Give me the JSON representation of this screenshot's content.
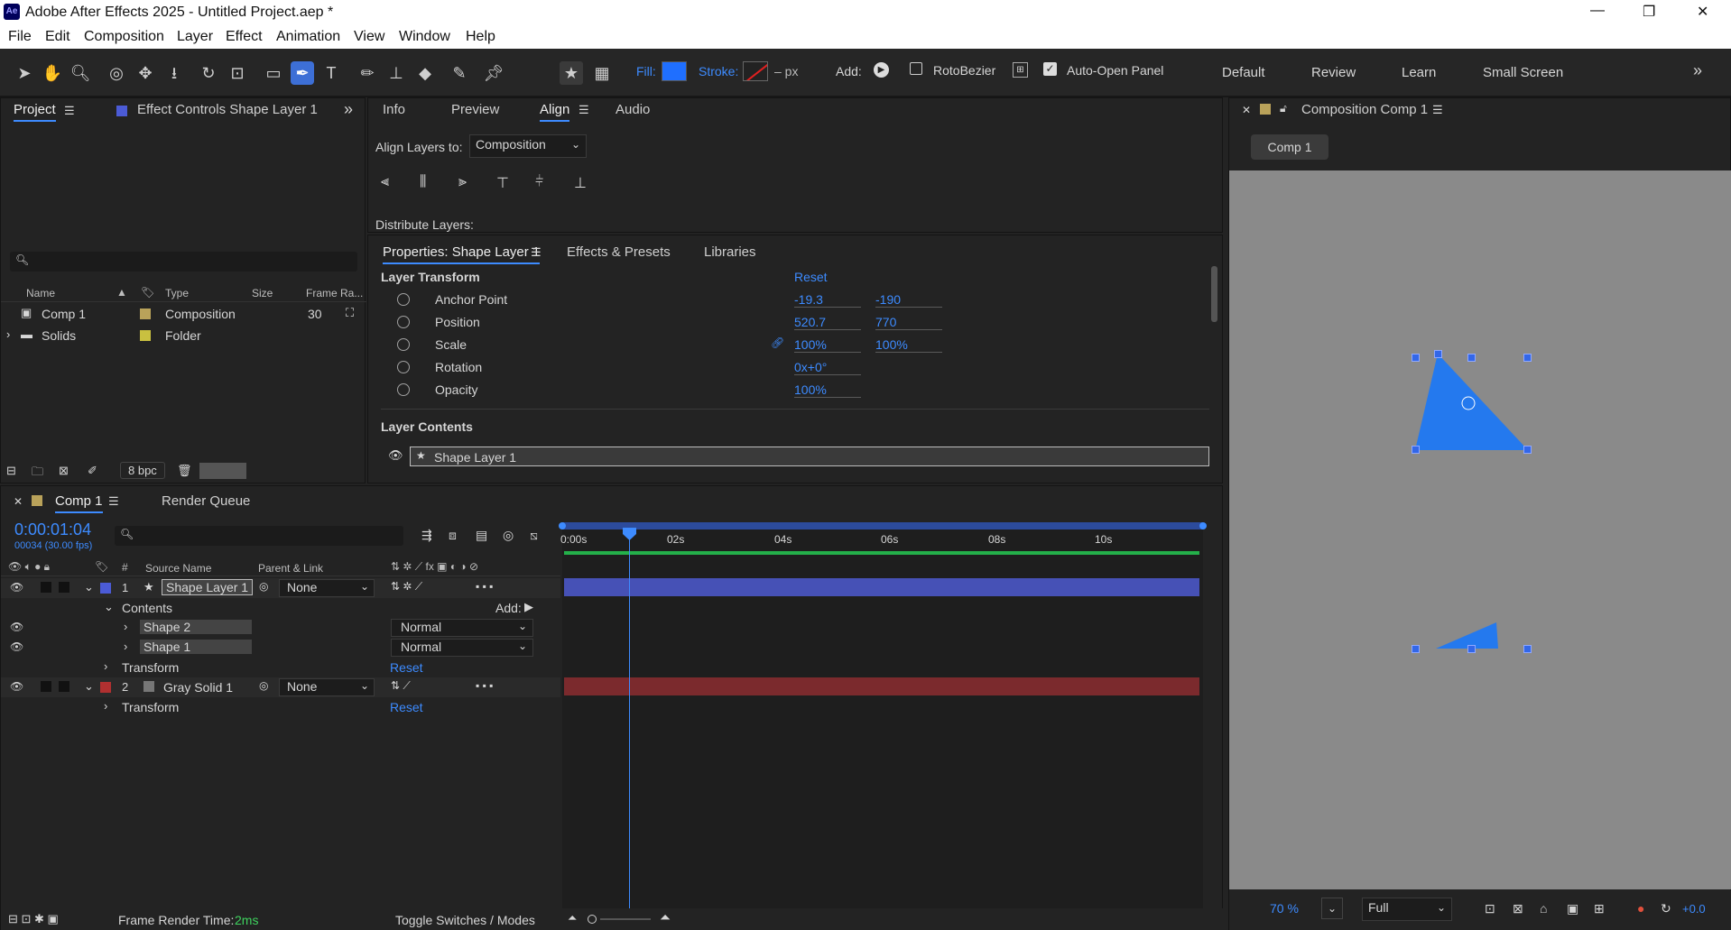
{
  "app": {
    "title": "Adobe After Effects 2025 - Untitled Project.aep *",
    "icon_label": "Ae"
  },
  "window_controls": {
    "minimize": "—",
    "restore": "❐",
    "close": "✕"
  },
  "menu": [
    "File",
    "Edit",
    "Composition",
    "Layer",
    "Effect",
    "Animation",
    "View",
    "Window",
    "Help"
  ],
  "toolbar": {
    "fill_label": "Fill:",
    "stroke_label": "Stroke:",
    "stroke_unit": "– px",
    "add_label": "Add:",
    "rotobezier_label": "RotoBezier",
    "auto_open_label": "Auto-Open Panel",
    "fill_color": "#1f6fff",
    "workspaces": [
      "Default",
      "Review",
      "Learn",
      "Small Screen"
    ]
  },
  "project_panel": {
    "tab_project": "Project",
    "tab_effect_controls": "Effect Controls Shape Layer 1",
    "columns": [
      "Name",
      "Type",
      "Size",
      "Frame Ra..."
    ],
    "items": [
      {
        "name": "Comp 1",
        "type": "Composition",
        "frame_rate": "30",
        "color": "#b9a25a"
      },
      {
        "name": "Solids",
        "type": "Folder",
        "frame_rate": "",
        "color": "#c9c040"
      }
    ],
    "bpc": "8 bpc"
  },
  "align_panel": {
    "tabs": [
      "Info",
      "Preview",
      "Align",
      "Audio"
    ],
    "align_layers_to_label": "Align Layers to:",
    "align_layers_to_value": "Composition",
    "distribute_label": "Distribute Layers:"
  },
  "properties_panel": {
    "tabs": [
      "Properties: Shape Layer 1",
      "Effects & Presets",
      "Libraries"
    ],
    "section_transform": "Layer Transform",
    "reset": "Reset",
    "props": [
      {
        "name": "Anchor Point",
        "v1": "-19.3",
        "v2": "-190"
      },
      {
        "name": "Position",
        "v1": "520.7",
        "v2": "770"
      },
      {
        "name": "Scale",
        "v1": "100%",
        "v2": "100%"
      },
      {
        "name": "Rotation",
        "v1": "0x+0°",
        "v2": ""
      },
      {
        "name": "Opacity",
        "v1": "100%",
        "v2": ""
      }
    ],
    "section_contents": "Layer Contents",
    "content_item": "Shape Layer 1"
  },
  "composition_panel": {
    "title": "Composition Comp 1",
    "comp_tab": "Comp 1",
    "zoom": "70 %",
    "resolution": "Full",
    "exposure": "+0.0",
    "shape_color": "#2479ee"
  },
  "timeline": {
    "tab_comp": "Comp 1",
    "tab_render": "Render Queue",
    "timecode": "0:00:01:04",
    "frame_info": "00034 (30.00 fps)",
    "col_source": "Source Name",
    "col_parent": "Parent & Link",
    "ruler": [
      "0:00s",
      "02s",
      "04s",
      "06s",
      "08s",
      "10s"
    ],
    "layers": [
      {
        "num": "1",
        "name": "Shape Layer 1",
        "parent": "None",
        "color": "#4b5bd6",
        "bar_color": "#4651b6"
      },
      {
        "num": "2",
        "name": "Gray Solid 1",
        "parent": "None",
        "color": "#b03030",
        "bar_color": "#7b2a2d"
      }
    ],
    "contents_label": "Contents",
    "add_label": "Add:",
    "shapes": [
      {
        "name": "Shape 2",
        "mode": "Normal"
      },
      {
        "name": "Shape 1",
        "mode": "Normal"
      }
    ],
    "transform_label": "Transform",
    "reset": "Reset",
    "render_time_label": "Frame Render Time:",
    "render_time_value": "2ms",
    "toggle_label": "Toggle Switches / Modes"
  }
}
